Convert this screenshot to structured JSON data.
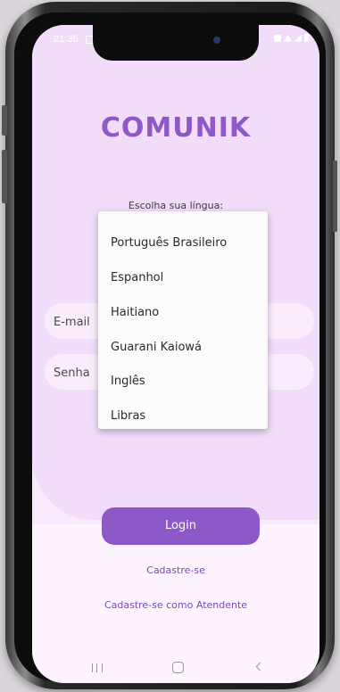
{
  "status_bar": {
    "time": "21:35"
  },
  "app": {
    "title": "COMUNIK"
  },
  "language": {
    "label": "Escolha sua língua:",
    "options": [
      "Português Brasileiro",
      "Espanhol",
      "Haitiano",
      "Guarani Kaiowá",
      "Inglês",
      "Libras"
    ]
  },
  "form": {
    "email_label": "E-mail",
    "password_label": "Senha"
  },
  "actions": {
    "login": "Login",
    "signup": "Cadastre-se",
    "signup_attendant": "Cadastre-se como Atendente"
  },
  "colors": {
    "accent": "#8d58c8",
    "link": "#7b49b6",
    "background": "#f9e9fd",
    "panel": "#f1dcfa"
  },
  "icons": {
    "nav": [
      "recent-apps-icon",
      "home-icon",
      "back-icon"
    ]
  }
}
